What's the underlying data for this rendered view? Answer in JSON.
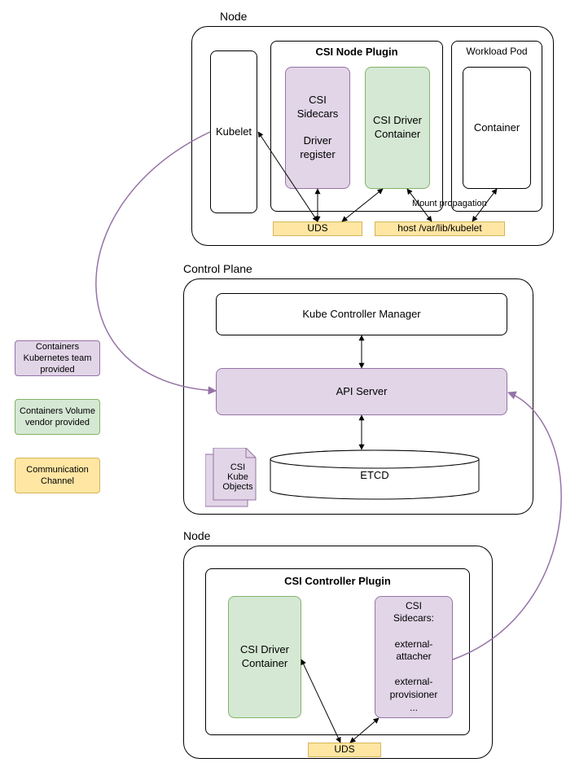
{
  "sections": {
    "node_top": "Node",
    "control_plane": "Control Plane",
    "node_bottom": "Node"
  },
  "node_top": {
    "kubelet": "Kubelet",
    "csi_node_plugin_title": "CSI Node Plugin",
    "csi_sidecars": "CSI\nSidecars\n\nDriver\nregister",
    "csi_driver_container": "CSI Driver\nContainer",
    "workload_pod_title": "Workload Pod",
    "container": "Container",
    "uds": "UDS",
    "host_path": "host /var/lib/kubelet",
    "mount_propagation": "Mount propagation"
  },
  "control_plane": {
    "kube_controller_manager": "Kube Controller Manager",
    "api_server": "API Server",
    "etcd": "ETCD",
    "csi_kube_objects": "CSI\nKube\nObjects"
  },
  "node_bottom": {
    "csi_controller_plugin_title": "CSI Controller Plugin",
    "csi_driver_container": "CSI Driver\nContainer",
    "csi_sidecars": "CSI\nSidecars:\n\nexternal-\nattacher\n\nexternal-\nprovisioner\n...",
    "uds": "UDS"
  },
  "legend": {
    "purple": "Containers\nKubernetes team\nprovided",
    "green": "Containers\nVolume vendor\nprovided",
    "yellow": "Communication\nChannel"
  },
  "chart_data": {
    "type": "diagram",
    "title": "Kubernetes CSI Architecture",
    "nodes": [
      {
        "id": "node-top",
        "label": "Node",
        "children": [
          "kubelet",
          "csi-node-plugin",
          "workload-pod",
          "uds-top",
          "host-path"
        ]
      },
      {
        "id": "kubelet",
        "label": "Kubelet",
        "kind": "component"
      },
      {
        "id": "csi-node-plugin",
        "label": "CSI Node Plugin",
        "children": [
          "csi-sidecars-node",
          "csi-driver-node"
        ]
      },
      {
        "id": "csi-sidecars-node",
        "label": "CSI Sidecars Driver register",
        "kind": "k8s-container"
      },
      {
        "id": "csi-driver-node",
        "label": "CSI Driver Container",
        "kind": "vendor-container"
      },
      {
        "id": "workload-pod",
        "label": "Workload Pod",
        "children": [
          "workload-container"
        ]
      },
      {
        "id": "workload-container",
        "label": "Container",
        "kind": "component"
      },
      {
        "id": "uds-top",
        "label": "UDS",
        "kind": "channel"
      },
      {
        "id": "host-path",
        "label": "host /var/lib/kubelet",
        "kind": "channel"
      },
      {
        "id": "control-plane",
        "label": "Control Plane",
        "children": [
          "kube-controller-manager",
          "api-server",
          "etcd",
          "csi-kube-objects"
        ]
      },
      {
        "id": "kube-controller-manager",
        "label": "Kube Controller Manager",
        "kind": "component"
      },
      {
        "id": "api-server",
        "label": "API Server",
        "kind": "k8s-container"
      },
      {
        "id": "etcd",
        "label": "ETCD",
        "kind": "storage"
      },
      {
        "id": "csi-kube-objects",
        "label": "CSI Kube Objects",
        "kind": "k8s-container"
      },
      {
        "id": "node-bottom",
        "label": "Node",
        "children": [
          "csi-controller-plugin",
          "uds-bottom"
        ]
      },
      {
        "id": "csi-controller-plugin",
        "label": "CSI Controller Plugin",
        "children": [
          "csi-driver-ctrl",
          "csi-sidecars-ctrl"
        ]
      },
      {
        "id": "csi-driver-ctrl",
        "label": "CSI Driver Container",
        "kind": "vendor-container"
      },
      {
        "id": "csi-sidecars-ctrl",
        "label": "CSI Sidecars: external-attacher external-provisioner ...",
        "kind": "k8s-container"
      },
      {
        "id": "uds-bottom",
        "label": "UDS",
        "kind": "channel"
      }
    ],
    "edges": [
      {
        "from": "kubelet",
        "to": "uds-top",
        "dir": "both"
      },
      {
        "from": "csi-sidecars-node",
        "to": "uds-top",
        "dir": "both"
      },
      {
        "from": "csi-driver-node",
        "to": "uds-top",
        "dir": "both"
      },
      {
        "from": "csi-driver-node",
        "to": "host-path",
        "dir": "both"
      },
      {
        "from": "workload-container",
        "to": "host-path",
        "dir": "both",
        "label": "Mount propagation"
      },
      {
        "from": "kubelet",
        "to": "api-server",
        "dir": "to"
      },
      {
        "from": "kube-controller-manager",
        "to": "api-server",
        "dir": "both"
      },
      {
        "from": "api-server",
        "to": "etcd",
        "dir": "both"
      },
      {
        "from": "csi-sidecars-ctrl",
        "to": "api-server",
        "dir": "to"
      },
      {
        "from": "csi-driver-ctrl",
        "to": "uds-bottom",
        "dir": "both"
      },
      {
        "from": "csi-sidecars-ctrl",
        "to": "uds-bottom",
        "dir": "both"
      }
    ],
    "legend": [
      {
        "color": "purple",
        "meaning": "Containers Kubernetes team provided"
      },
      {
        "color": "green",
        "meaning": "Containers Volume vendor provided"
      },
      {
        "color": "yellow",
        "meaning": "Communication Channel"
      }
    ]
  }
}
